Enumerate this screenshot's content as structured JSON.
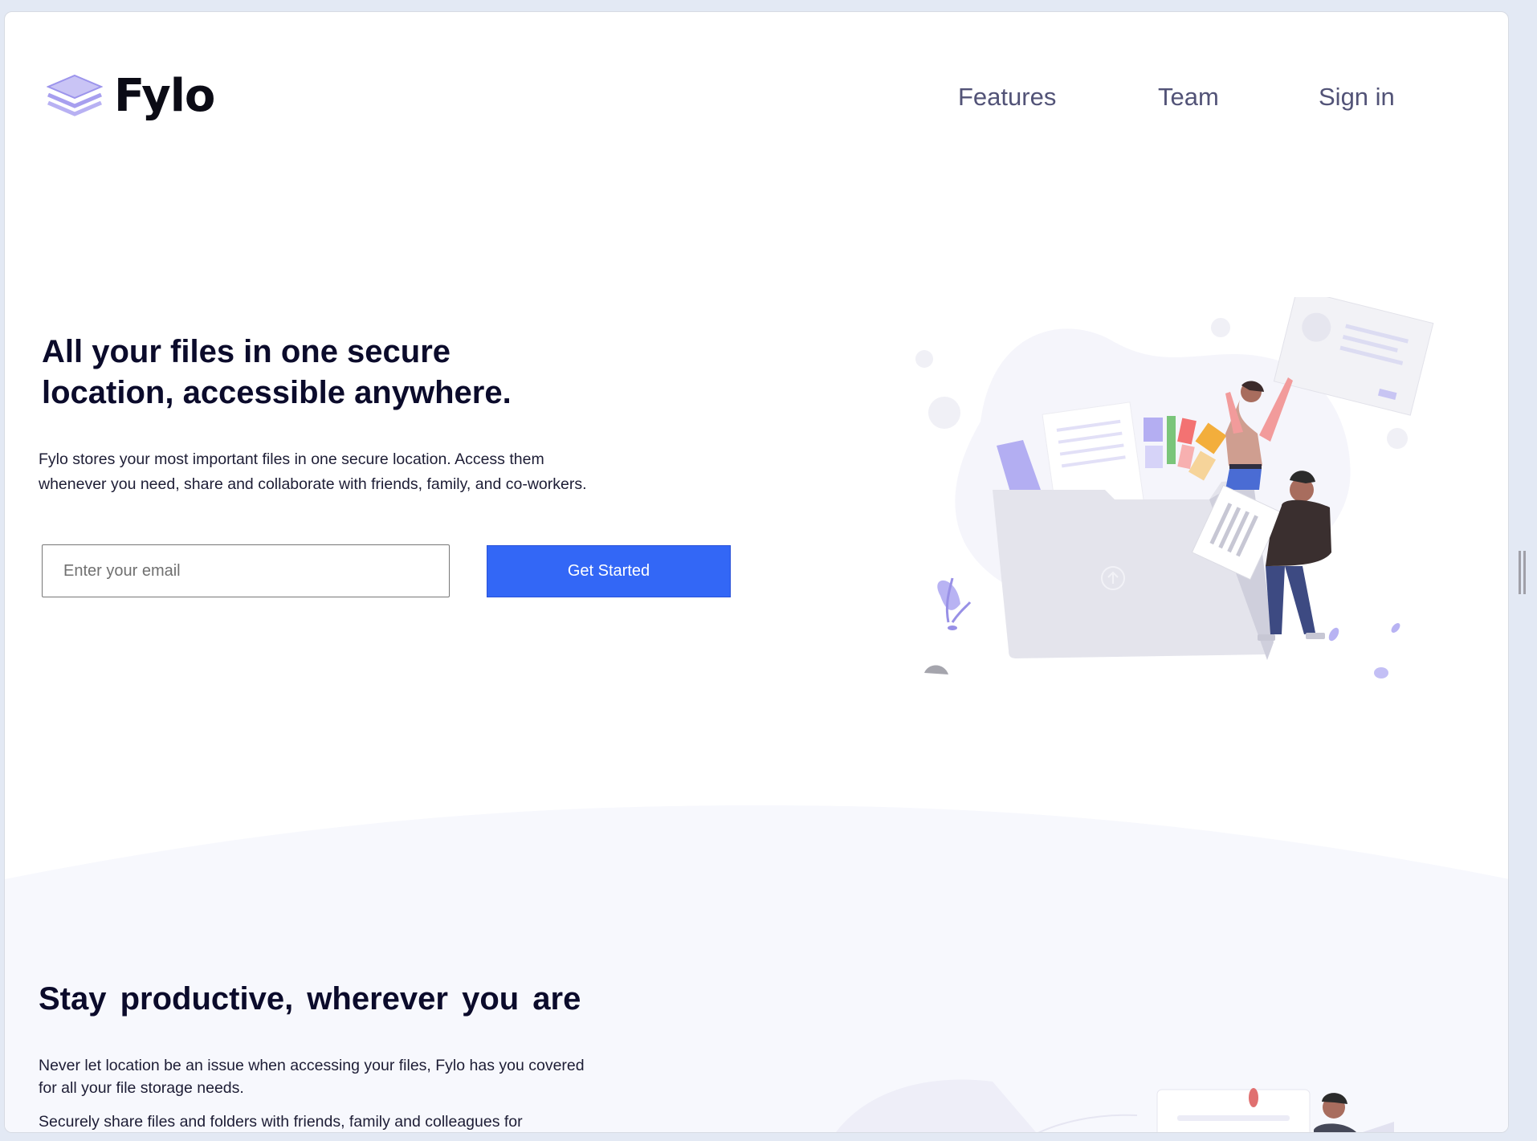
{
  "header": {
    "brand": "Fylo",
    "nav": [
      {
        "label": "Features"
      },
      {
        "label": "Team"
      },
      {
        "label": "Sign in"
      }
    ]
  },
  "hero": {
    "title_line1": "All your files in one secure",
    "title_line2": "location, accessible anywhere.",
    "description": "Fylo stores your most important files in one secure location. Access them whenever you need, share and collaborate with friends, family, and co-workers.",
    "email_placeholder": "Enter your email",
    "cta_label": "Get Started"
  },
  "productive": {
    "title": "Stay productive, wherever you are",
    "description": "Never let location be an issue when accessing your files, Fylo has you covered for all your file storage needs.",
    "next_paragraph": "Securely share files and folders with friends, family and colleagues for"
  },
  "colors": {
    "accent": "#3367f6",
    "heading": "#0b0b2b",
    "nav": "#525377",
    "section_bg": "#f7f8fd"
  }
}
